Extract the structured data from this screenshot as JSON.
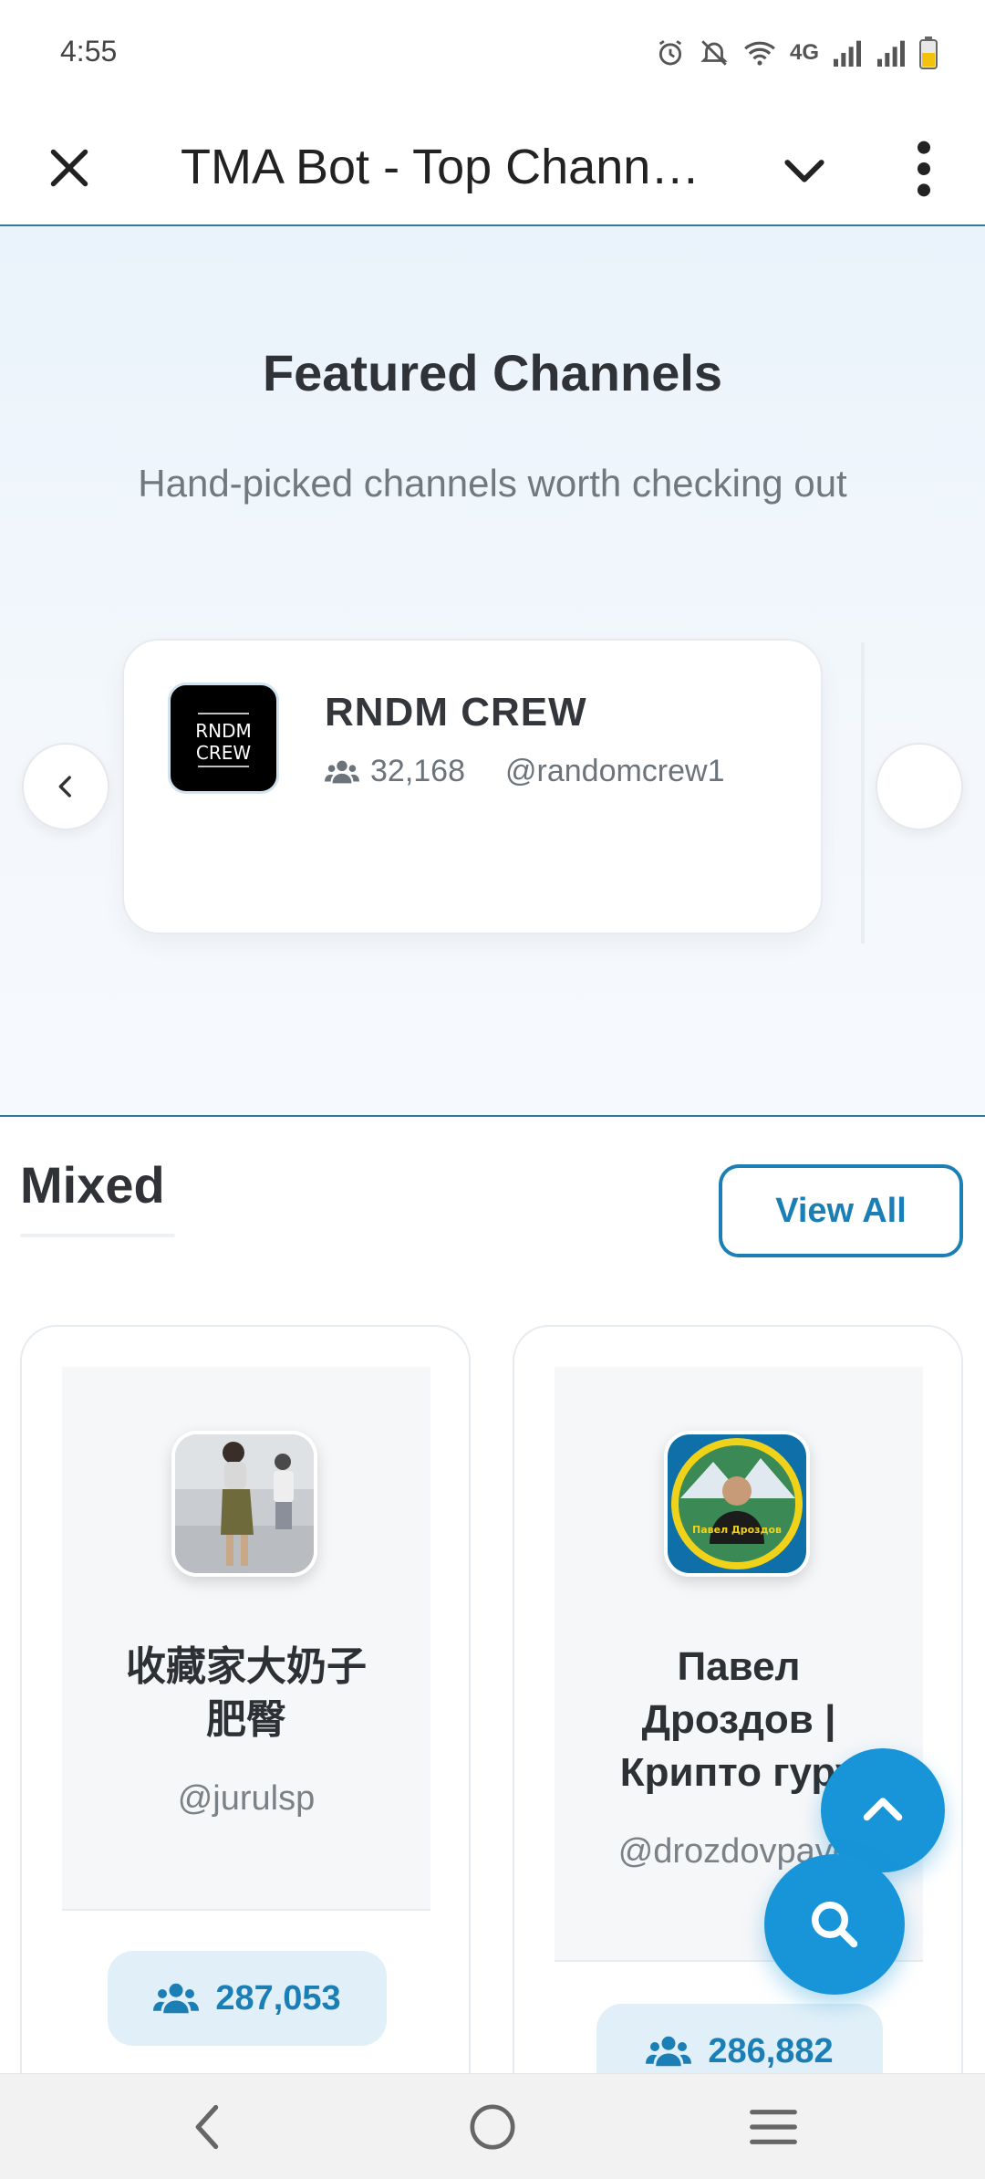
{
  "status_bar": {
    "time": "4:55",
    "network": "4G",
    "icons": [
      "alarm-icon",
      "mute-icon",
      "wifi-icon",
      "signal-icon",
      "signal-icon",
      "battery-icon"
    ]
  },
  "app_bar": {
    "title": "TMA Bot - Top Chann…",
    "icons": [
      "close-icon",
      "chevron-down-icon",
      "more-vert-icon"
    ]
  },
  "featured": {
    "title": "Featured Channels",
    "subtitle": "Hand-picked channels worth checking out",
    "card": {
      "name": "RNDM CREW",
      "logo_text_line1": "RNDM",
      "logo_text_line2": "CREW",
      "subscribers": "32,168",
      "handle": "@randomcrew1"
    }
  },
  "mixed": {
    "title": "Mixed",
    "view_all_label": "View All",
    "channels": [
      {
        "name_line1": "收藏家大奶子",
        "name_line2": "肥臀",
        "name_line3": "",
        "handle": "@jurulsp",
        "subscribers": "287,053"
      },
      {
        "name_line1": "Павел",
        "name_line2": "Дроздов |",
        "name_line3": "Крипто гуру",
        "handle": "@drozdovpavel",
        "subscribers": "286,882",
        "avatar_text": "Павел Дроздов"
      }
    ]
  },
  "colors": {
    "accent": "#1795d8",
    "link": "#1b7fb6",
    "badge_bg": "#e1f0f8",
    "divider": "#2f7c9a"
  }
}
